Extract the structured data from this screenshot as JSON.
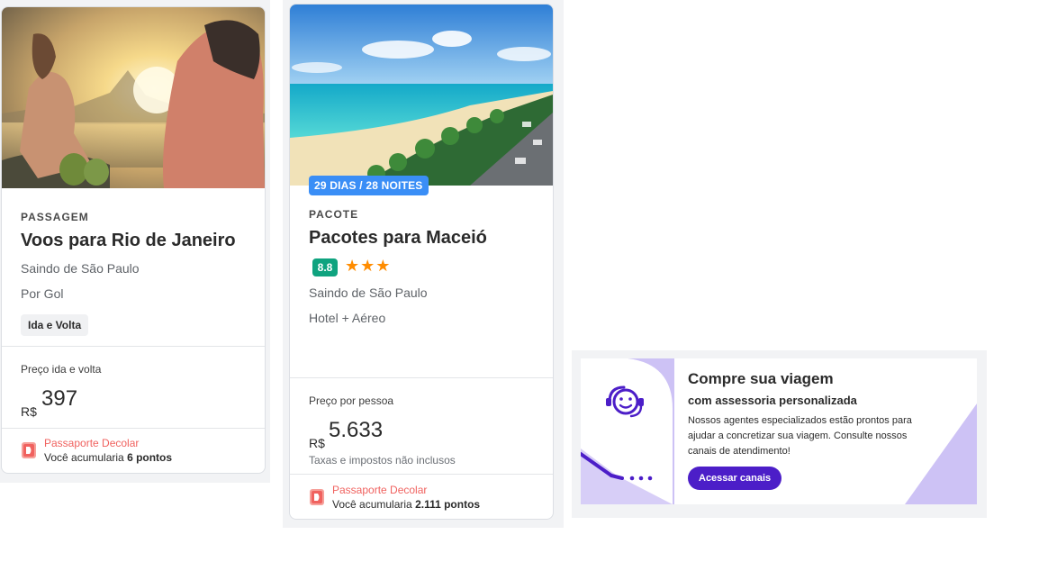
{
  "card1": {
    "image": "beach-sunset-rio-photo",
    "tag": "PASSAGEM",
    "title": "Voos para Rio de Janeiro",
    "origin": "Saindo de São Paulo",
    "airline": "Por Gol",
    "trip_chip": "Ida e Volta",
    "price_label": "Preço ida e volta",
    "currency": "R$",
    "price": "397",
    "passport_title": "Passaporte Decolar",
    "passport_prefix": "Você acumularia ",
    "passport_points": "6 pontos"
  },
  "card2": {
    "image": "maceio-beach-aerial-photo",
    "duration_badge": "29 DIAS / 28 NOITES",
    "tag": "PACOTE",
    "title": "Pacotes para Maceió",
    "rating": "8.8",
    "stars": "★★★",
    "origin": "Saindo de São Paulo",
    "package_type": "Hotel + Aéreo",
    "price_label": "Preço por pessoa",
    "currency": "R$",
    "price": "5.633",
    "taxes_note": "Taxas e impostos não inclusos",
    "passport_title": "Passaporte Decolar",
    "passport_prefix": "Você acumularia ",
    "passport_points": "2.111 pontos"
  },
  "banner": {
    "title": "Compre sua viagem",
    "subtitle": "com assessoria personalizada",
    "text": "Nossos agentes especializados estão prontos para ajudar a concretizar sua viagem. Consulte nossos canais de atendimento!",
    "button": "Acessar canais"
  },
  "colors": {
    "accent_purple": "#4c1ec8",
    "lavender": "#cdc2f5",
    "passport_red": "#f0625f",
    "badge_blue": "#3a8ef6",
    "score_green": "#0fa37f",
    "star_orange": "#ff8c00"
  }
}
